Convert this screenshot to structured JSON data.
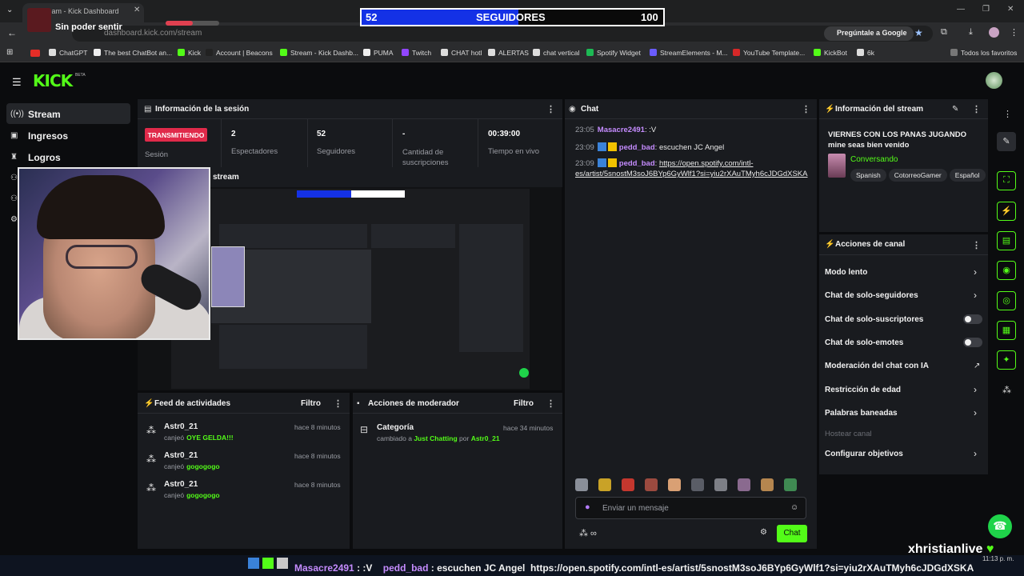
{
  "browser": {
    "tab_title": "Stream - Kick Dashboard",
    "url": "dashboard.kick.com/stream",
    "ask_google": "Pregúntale a Google",
    "bookmarks": [
      "ChatGPT",
      "The best ChatBot an...",
      "Kick",
      "Account | Beacons",
      "Stream - Kick Dashb...",
      "PUMA",
      "Twitch",
      "CHAT hotl",
      "ALERTAS",
      "chat vertical",
      "Spotify Widget",
      "StreamElements - M...",
      "YouTube Template...",
      "KickBot",
      "6k"
    ],
    "all_favorites": "Todos los favoritos"
  },
  "overlay": {
    "now_playing": "Sin poder sentir",
    "followers_current": "52",
    "followers_label": "SEGUIDORES",
    "followers_goal": "100",
    "followers_progress": 0.52,
    "brand_name": "xhristianlive",
    "clock": "11:13 p. m.",
    "ticker": {
      "user1": "Masacre2491",
      "msg1": ":V",
      "user2": "pedd_bad",
      "msg2": "escuchen JC Angel",
      "link": "https://open.spotify.com/intl-es/artist/5snostM3soJ6BYp6GyWlf1?si=yiu2rXAuTMyh6cJDGdXSKA"
    }
  },
  "header": {
    "logo": "KICK",
    "beta": "BETA"
  },
  "sidebar": {
    "items": [
      {
        "label": "Stream"
      },
      {
        "label": "Ingresos"
      },
      {
        "label": "Logros"
      }
    ]
  },
  "session": {
    "title": "Información de la sesión",
    "status": "TRANSMITIENDO",
    "status_label": "Sesión",
    "stats": [
      {
        "value": "2",
        "label": "Espectadores"
      },
      {
        "value": "52",
        "label": "Seguidores"
      },
      {
        "value": "-",
        "label": "Cantidad de suscripciones"
      },
      {
        "value": "00:39:00",
        "label": "Tiempo en vivo"
      }
    ],
    "preview_label": "stream"
  },
  "chat": {
    "title": "Chat",
    "messages": [
      {
        "time": "23:05",
        "user": "Masacre2491",
        "text": ":V"
      },
      {
        "time": "23:09",
        "user": "pedd_bad",
        "text": "escuchen JC Angel"
      },
      {
        "time": "23:09",
        "user": "pedd_bad",
        "text": "https://open.spotify.com/intl-",
        "text2": "es/artist/5snostM3soJ6BYp6GyWlf1?si=yiu2rXAuTMyh6cJDGdXSKA"
      }
    ],
    "input_placeholder": "Enviar un mensaje",
    "send_label": "Chat"
  },
  "stream_info": {
    "title": "Información del stream",
    "stream_title": "VIERNES CON LOS PANAS JUGANDO mine seas bien venido",
    "category": "Conversando",
    "tags": [
      "Spanish",
      "CotorreoGamer",
      "Español"
    ]
  },
  "channel_actions": {
    "title": "Acciones de canal",
    "items": [
      {
        "label": "Modo lento"
      },
      {
        "label": "Chat de solo-seguidores"
      },
      {
        "label": "Chat de solo-suscriptores"
      },
      {
        "label": "Chat de solo-emotes"
      },
      {
        "label": "Moderación del chat con IA"
      },
      {
        "label": "Restricción de edad"
      },
      {
        "label": "Palabras baneadas"
      },
      {
        "label": "Hostear canal"
      },
      {
        "label": "Configurar objetivos"
      }
    ]
  },
  "activity": {
    "title": "Feed de actividades",
    "filter": "Filtro",
    "items": [
      {
        "user": "Astr0_21",
        "prefix": "canjeó",
        "reward": "OYE GELDA!!!",
        "time": "hace 8 minutos"
      },
      {
        "user": "Astr0_21",
        "prefix": "canjeó",
        "reward": "gogogogo",
        "time": "hace 8 minutos"
      },
      {
        "user": "Astr0_21",
        "prefix": "canjeó",
        "reward": "gogogogo",
        "time": "hace 8 minutos"
      }
    ]
  },
  "moderator": {
    "title": "Acciones de moderador",
    "filter": "Filtro",
    "items": [
      {
        "title": "Categoría",
        "prefix": "cambiado a",
        "value": "Just Chatting",
        "by": "por",
        "user": "Astr0_21",
        "time": "hace 34 minutos"
      }
    ]
  },
  "colors": {
    "accent": "#53fc18",
    "live": "#e02a4a",
    "panel": "#191b1f",
    "bg": "#0b0c0e"
  }
}
